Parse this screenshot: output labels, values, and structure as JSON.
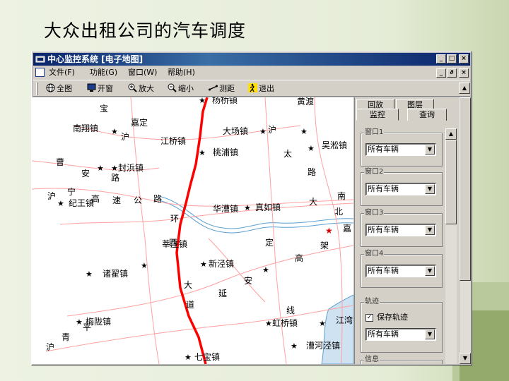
{
  "slide": {
    "title": "大众出租公司的汽车调度"
  },
  "window": {
    "title": "中心监控系统 [电子地图]",
    "controls": {
      "min": "_",
      "max": "□",
      "close": "×"
    },
    "child_controls": {
      "min": "_",
      "restore": "∂",
      "close": "×"
    }
  },
  "menu": [
    {
      "label": "文件(F)"
    },
    {
      "label": "功能(G)"
    },
    {
      "label": "窗口(W)"
    },
    {
      "label": "帮助(H)"
    }
  ],
  "toolbar": [
    {
      "label": "全图",
      "icon": "globe-icon"
    },
    {
      "label": "开窗",
      "icon": "monitor-icon"
    },
    {
      "label": "放大",
      "icon": "zoom-in-icon"
    },
    {
      "label": "缩小",
      "icon": "zoom-out-icon"
    },
    {
      "label": "测距",
      "icon": "ruler-icon"
    },
    {
      "label": "退出",
      "icon": "exit-icon"
    }
  ],
  "panel": {
    "tabs": [
      "回放",
      "图层",
      "监控",
      "查询"
    ],
    "groups": [
      {
        "label": "窗口1",
        "value": "所有车辆"
      },
      {
        "label": "窗口2",
        "value": "所有车辆"
      },
      {
        "label": "窗口3",
        "value": "所有车辆"
      },
      {
        "label": "窗口4",
        "value": "所有车辆"
      }
    ],
    "track": {
      "label": "轨迹",
      "checkbox_label": "保存轨迹",
      "checked": true,
      "value": "所有车辆"
    },
    "info": {
      "label": "信息"
    }
  },
  "scroll": {
    "up": "▲",
    "down": "▼",
    "check": "✓",
    "arrow": "▼"
  },
  "map": {
    "labels": {
      "l1": "杨桥镇",
      "l2": "黄渡",
      "l3": "南翔镇",
      "l4": "嘉定",
      "l5": "大场镇",
      "l6": "桃浦镇",
      "l7": "江桥镇",
      "l8": "封浜镇",
      "l9": "曹",
      "l10": "安",
      "l11": "路",
      "l12": "沪",
      "l13": "宁",
      "l14": "高",
      "l15": "速",
      "l16": "公",
      "l17": "路",
      "l18": "纪王镇",
      "l19": "华漕镇",
      "l20": "新泾镇",
      "l21": "虹桥镇",
      "l22": "莘庄镇",
      "l23": "漕河泾镇",
      "l24": "梅陇镇",
      "l25": "七宝镇",
      "l26": "真如镇",
      "l27": "诸翟镇",
      "l28": "环",
      "l29": "西",
      "l30": "大",
      "l31": "道",
      "l32": "延",
      "l33": "安",
      "l34": "高",
      "l35": "架",
      "l36": "南",
      "l37": "北",
      "l38": "线",
      "l39": "青",
      "l40": "平",
      "l41": "沪",
      "l42": "太",
      "l43": "路",
      "l44": "吴淞镇",
      "l45": "江湾镇",
      "l46": "宝",
      "l47": "沪",
      "l48": "大",
      "l49": "嘉",
      "l50": "定",
      "l51": "沪"
    }
  },
  "colors": {
    "titlebar": "#0a246a",
    "route": "#ff0000",
    "roads": "#ffa0a0",
    "river": "#5a9fd0"
  }
}
